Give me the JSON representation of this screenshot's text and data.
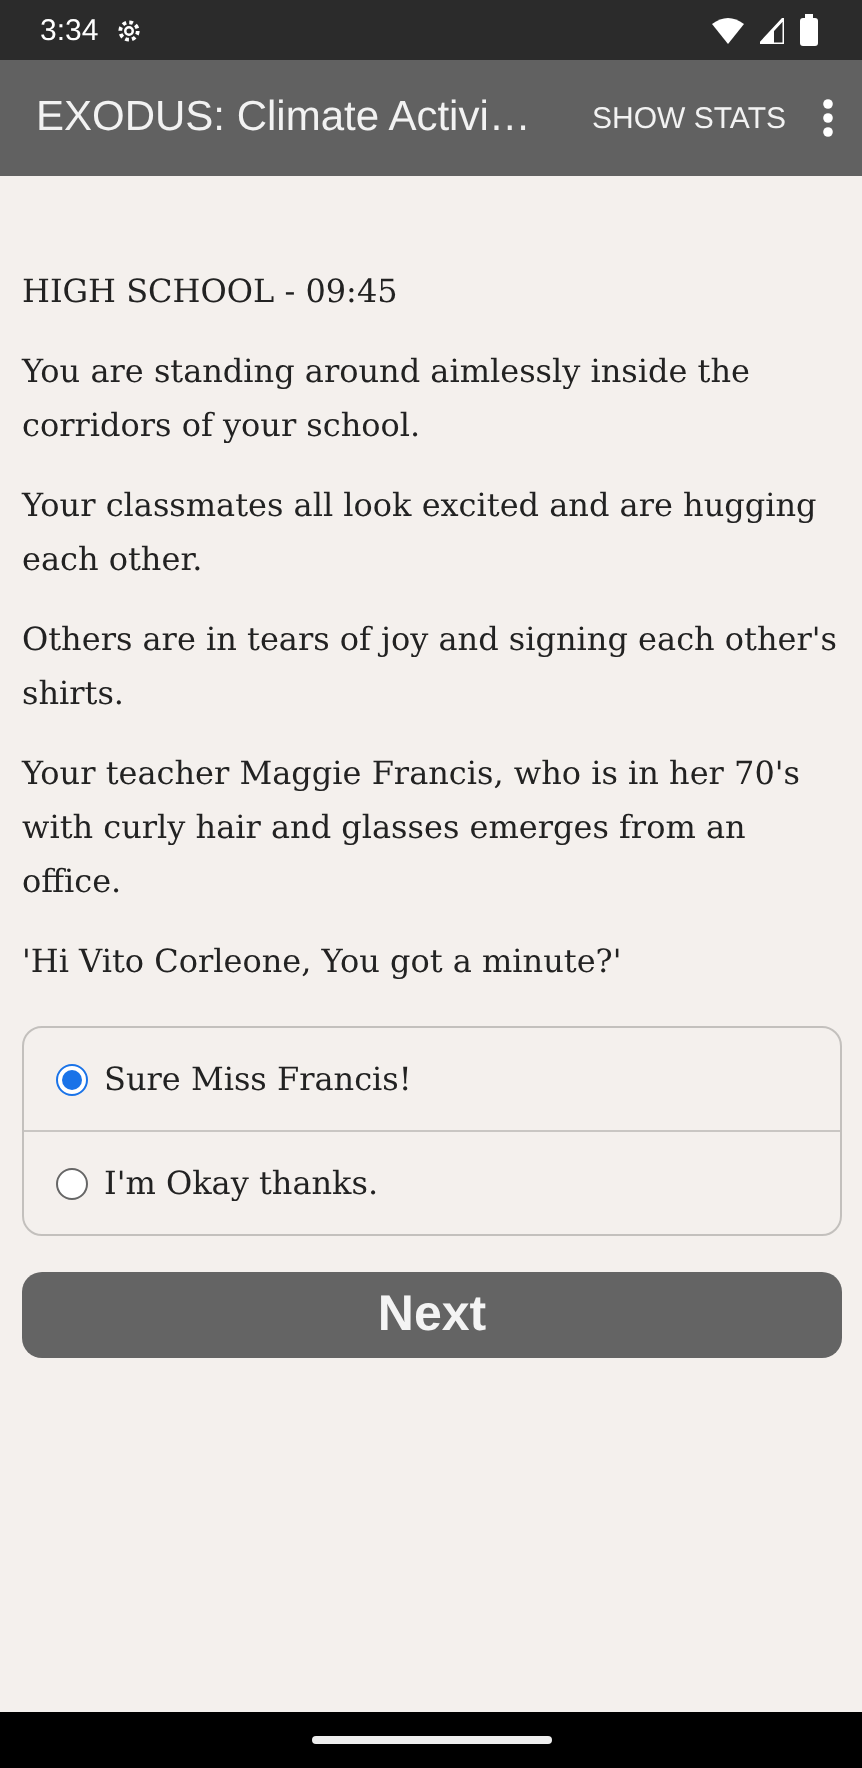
{
  "status_bar": {
    "time": "3:34"
  },
  "app_bar": {
    "title": "EXODUS: Climate Activi…",
    "action": "SHOW STATS"
  },
  "paragraphs": [
    "HIGH SCHOOL - 09:45",
    "You are standing around aimlessly inside the corridors of your school.",
    "Your classmates all look excited and are hugging each other.",
    "Others are in tears of joy and signing each other's shirts.",
    "Your teacher Maggie Francis, who is in her 70's with curly hair and glasses emerges from an office.",
    "'Hi Vito Corleone, You got a minute?'"
  ],
  "choices": [
    {
      "label": "Sure Miss Francis!",
      "selected": true
    },
    {
      "label": "I'm Okay thanks.",
      "selected": false
    }
  ],
  "next_button": "Next"
}
